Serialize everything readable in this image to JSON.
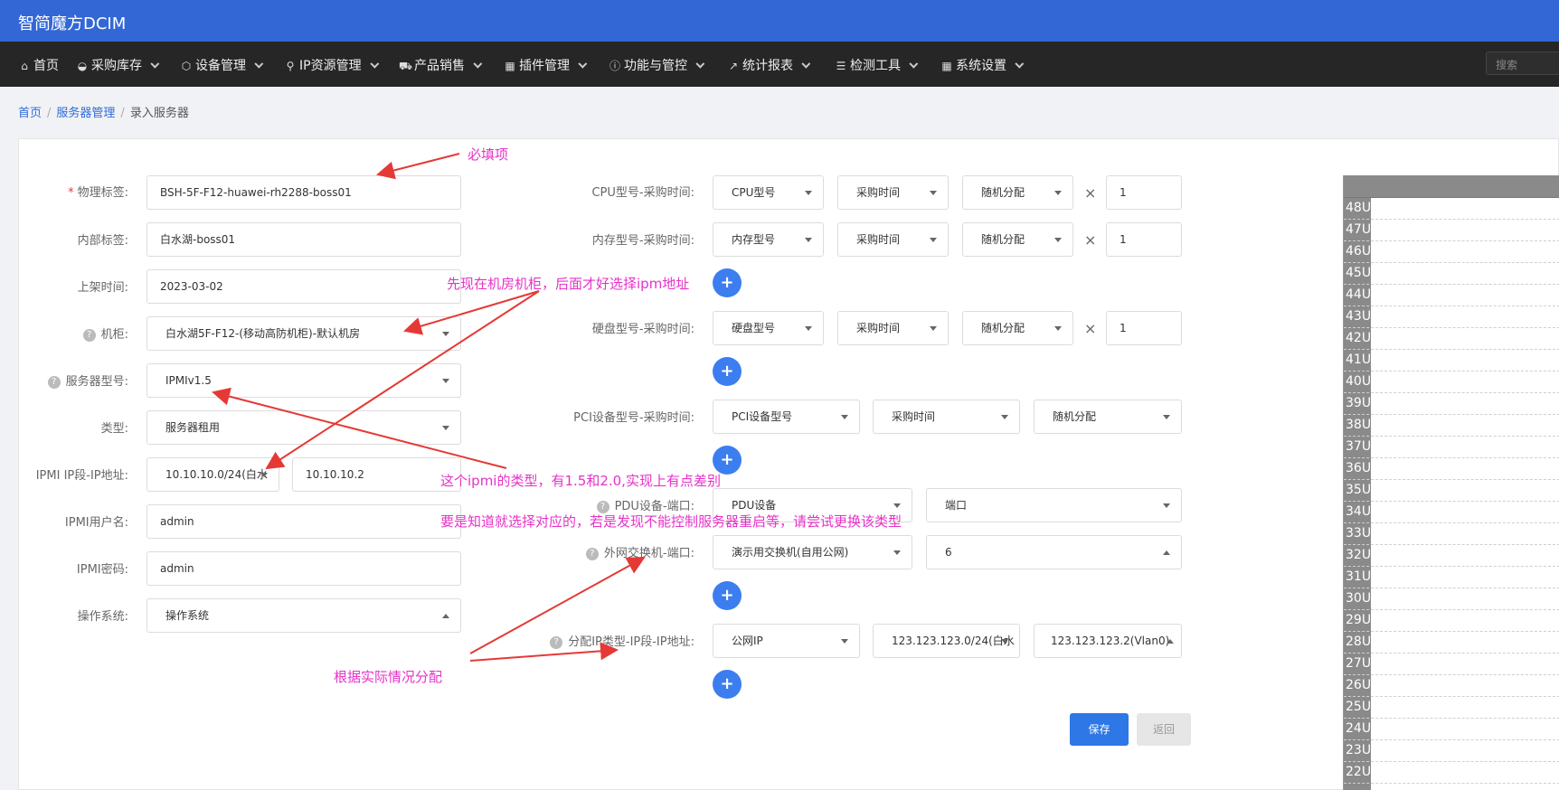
{
  "app": {
    "title": "智简魔方DCIM"
  },
  "nav": {
    "items": [
      {
        "icon": "home-icon",
        "glyph": "⌂",
        "label": "首页",
        "caret": false
      },
      {
        "icon": "shopping-icon",
        "glyph": "◒",
        "label": "采购库存",
        "caret": true
      },
      {
        "icon": "cube-icon",
        "glyph": "⬡",
        "label": "设备管理",
        "caret": true
      },
      {
        "icon": "location-pin-icon",
        "glyph": "⚲",
        "label": "IP资源管理",
        "caret": true
      },
      {
        "icon": "cart-icon",
        "glyph": "⛟",
        "label": "产品销售",
        "caret": true
      },
      {
        "icon": "grid-icon",
        "glyph": "▦",
        "label": "插件管理",
        "caret": true
      },
      {
        "icon": "info-icon",
        "glyph": "ⓘ",
        "label": "功能与管控",
        "caret": true
      },
      {
        "icon": "line-chart-icon",
        "glyph": "↗",
        "label": "统计报表",
        "caret": true
      },
      {
        "icon": "list-icon",
        "glyph": "☰",
        "label": "检测工具",
        "caret": true
      },
      {
        "icon": "apps-icon",
        "glyph": "▦",
        "label": "系统设置",
        "caret": true
      }
    ],
    "search_placeholder": "搜索"
  },
  "breadcrumb": {
    "home": "首页",
    "section": "服务器管理",
    "current": "录入服务器"
  },
  "form_left": {
    "physical_tag": {
      "label": "物理标签:",
      "value": "BSH-5F-F12-huawei-rh2288-boss01"
    },
    "internal_tag": {
      "label": "内部标签:",
      "value": "白水湖-boss01"
    },
    "rack_time": {
      "label": "上架时间:",
      "value": "2023-03-02"
    },
    "cabinet": {
      "label": "机柜:",
      "value": "白水湖5F-F12-(移动高防机柜)-默认机房"
    },
    "server_model": {
      "label": "服务器型号:",
      "value": "IPMIv1.5"
    },
    "type": {
      "label": "类型:",
      "value": "服务器租用"
    },
    "ipmi_ip": {
      "label": "IPMI IP段-IP地址:",
      "segment": "10.10.10.0/24(白水",
      "address": "10.10.10.2"
    },
    "ipmi_user": {
      "label": "IPMI用户名:",
      "value": "admin"
    },
    "ipmi_pass": {
      "label": "IPMI密码:",
      "value": "admin"
    },
    "os": {
      "label": "操作系统:",
      "value": "操作系统"
    }
  },
  "form_right": {
    "cpu": {
      "label": "CPU型号-采购时间:",
      "model": "CPU型号",
      "time": "采购时间",
      "alloc": "随机分配",
      "times": "×",
      "qty": "1"
    },
    "mem": {
      "label": "内存型号-采购时间:",
      "model": "内存型号",
      "time": "采购时间",
      "alloc": "随机分配",
      "times": "×",
      "qty": "1"
    },
    "disk": {
      "label": "硬盘型号-采购时间:",
      "model": "硬盘型号",
      "time": "采购时间",
      "alloc": "随机分配",
      "times": "×",
      "qty": "1"
    },
    "pci": {
      "label": "PCI设备型号-采购时间:",
      "model": "PCI设备型号",
      "time": "采购时间",
      "alloc": "随机分配"
    },
    "pdu": {
      "label": "PDU设备-端口:",
      "device": "PDU设备",
      "port": "端口"
    },
    "switch": {
      "label": "外网交换机-端口:",
      "device": "演示用交换机(自用公网)",
      "port": "6"
    },
    "ip_alloc": {
      "label": "分配IP类型-IP段-IP地址:",
      "type": "公网IP",
      "segment": "123.123.123.0/24(白水",
      "address": "123.123.123.2(Vlan0)"
    },
    "plus": "+"
  },
  "actions": {
    "save": "保存",
    "back": "返回"
  },
  "annotations": {
    "required": "必填项",
    "cabinet_first": "先现在机房机柜，后面才好选择ipm地址",
    "ipmi_type_1": "这个ipmi的类型，有1.5和2.0,实现上有点差别",
    "ipmi_type_2": "要是知道就选择对应的，若是发现不能控制服务器重启等，请尝试更换该类型",
    "allocate": "根据实际情况分配"
  },
  "rack": {
    "units": [
      "48U",
      "47U",
      "46U",
      "45U",
      "44U",
      "43U",
      "42U",
      "41U",
      "40U",
      "39U",
      "38U",
      "37U",
      "36U",
      "35U",
      "34U",
      "33U",
      "32U",
      "31U",
      "30U",
      "29U",
      "28U",
      "27U",
      "26U",
      "25U",
      "24U",
      "23U",
      "22U"
    ]
  },
  "colors": {
    "topbar": "#3367d6",
    "navbar": "#262626",
    "primary": "#2d77e6",
    "annotation": "#e632c8",
    "arrow": "#e53935"
  }
}
